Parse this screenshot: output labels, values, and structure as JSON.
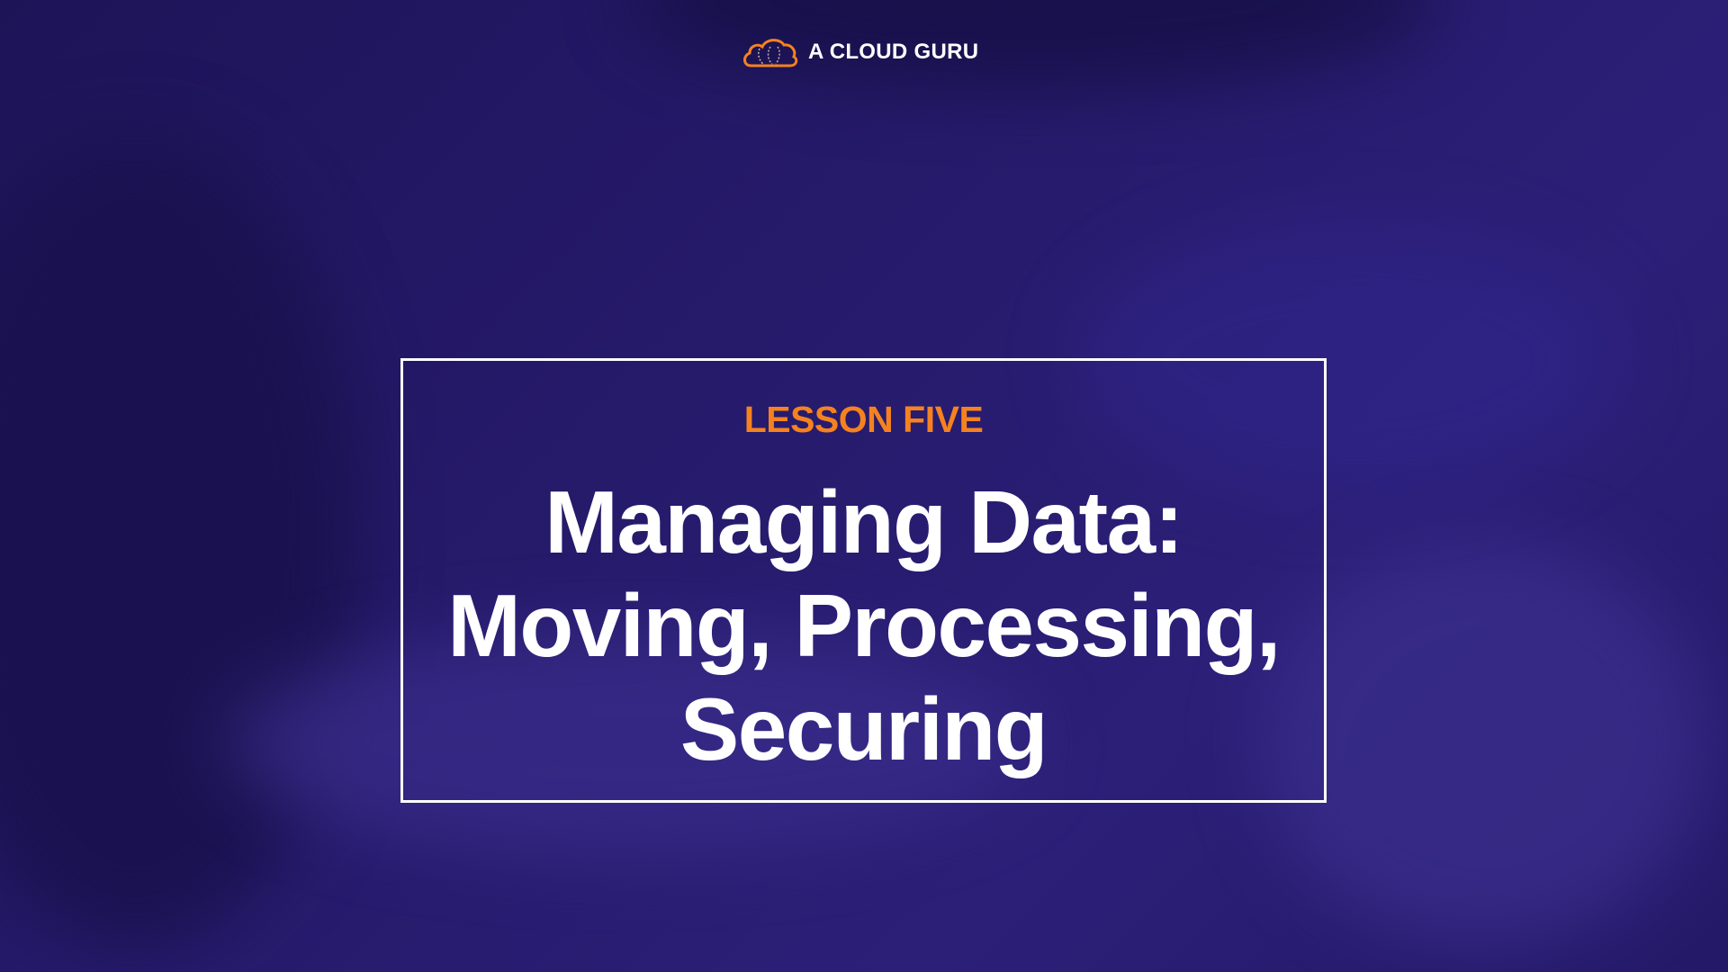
{
  "brand": {
    "name": "A CLOUD GURU",
    "logo_icon": "cloud-icon",
    "logo_color": "#f5821f"
  },
  "slide": {
    "kicker": "LESSON FIVE",
    "title_lines": [
      "Managing Data:",
      "Moving, Processing,",
      "Securing"
    ]
  },
  "colors": {
    "accent": "#f5821f",
    "background": "#261a6b",
    "text": "#ffffff"
  }
}
